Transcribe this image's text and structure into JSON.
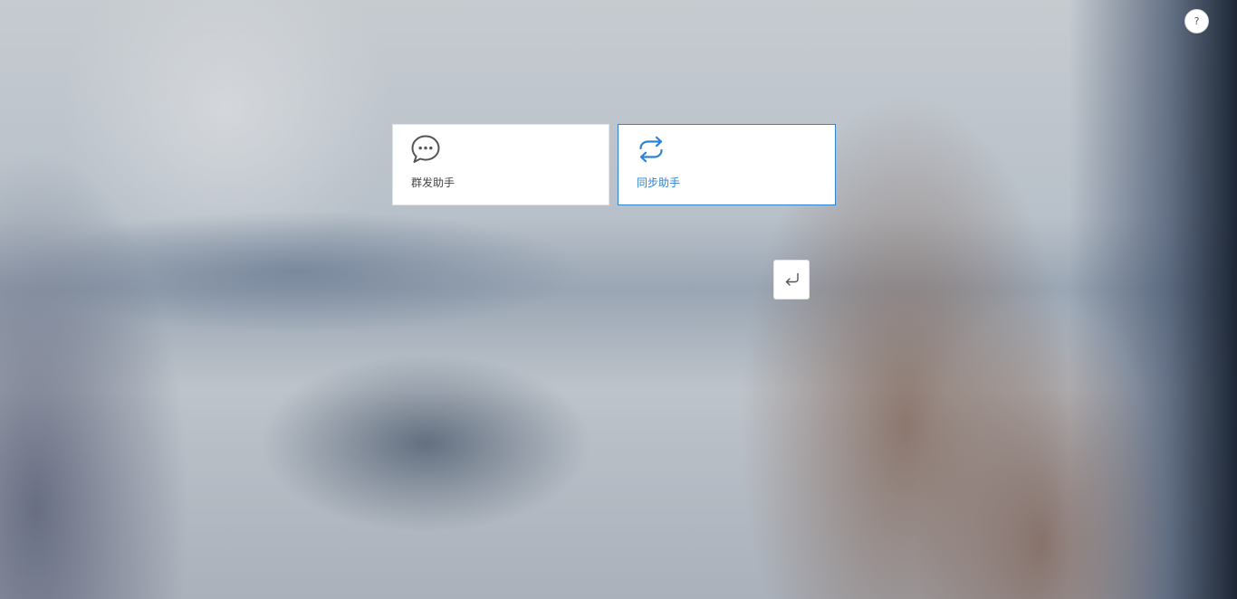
{
  "help": {
    "label": "?"
  },
  "cards": [
    {
      "label": "群发助手",
      "icon": "chat-bubble-icon",
      "color": "#555555"
    },
    {
      "label": "同步助手",
      "icon": "sync-arrows-icon",
      "color": "#2f83d2"
    }
  ],
  "back": {
    "icon": "return-arrow-icon"
  },
  "colors": {
    "accent": "#2f83d2",
    "card_bg": "#ffffff",
    "text": "#444444"
  }
}
